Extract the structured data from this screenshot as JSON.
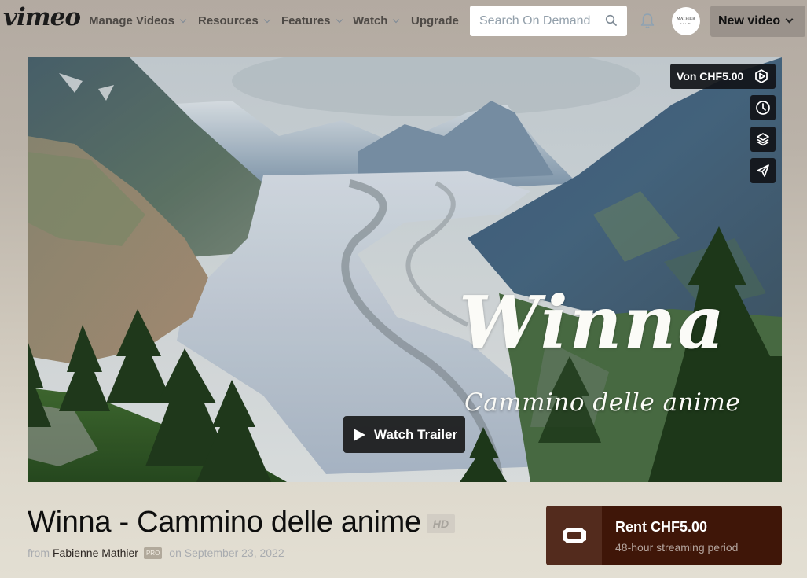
{
  "nav": {
    "logo": "vimeo",
    "items": [
      {
        "label": "Manage Videos",
        "has_dropdown": true
      },
      {
        "label": "Resources",
        "has_dropdown": true
      },
      {
        "label": "Features",
        "has_dropdown": true
      },
      {
        "label": "Watch",
        "has_dropdown": true
      },
      {
        "label": "Upgrade",
        "has_dropdown": false
      }
    ],
    "search": {
      "placeholder": "Search On Demand",
      "value": ""
    },
    "notifications_icon": "bell-icon",
    "avatar": {
      "line1": "MATHIER",
      "line2": "FILM"
    },
    "new_video_label": "New video"
  },
  "hero": {
    "overlay_title": "Winna",
    "overlay_subtitle": "Cammino delle anime",
    "watch_trailer_label": "Watch Trailer",
    "price_pill_label": "Von CHF5.00",
    "side_actions": [
      {
        "icon": "clock-icon",
        "label": "Watch later"
      },
      {
        "icon": "layers-icon",
        "label": "Add to collection"
      },
      {
        "icon": "send-icon",
        "label": "Share"
      }
    ]
  },
  "video": {
    "title": "Winna - Cammino delle anime",
    "quality_badge": "HD",
    "from_label": "from",
    "author": "Fabienne Mathier",
    "author_badge": "PRO",
    "date": "on September 23, 2022"
  },
  "rent": {
    "title": "Rent CHF5.00",
    "subtitle": "48-hour streaming period",
    "icon": "ticket-icon"
  },
  "colors": {
    "rent_bg": "#3f1608",
    "rent_icon_bg": "#532b1d",
    "overlay_button_bg": "#111318"
  }
}
